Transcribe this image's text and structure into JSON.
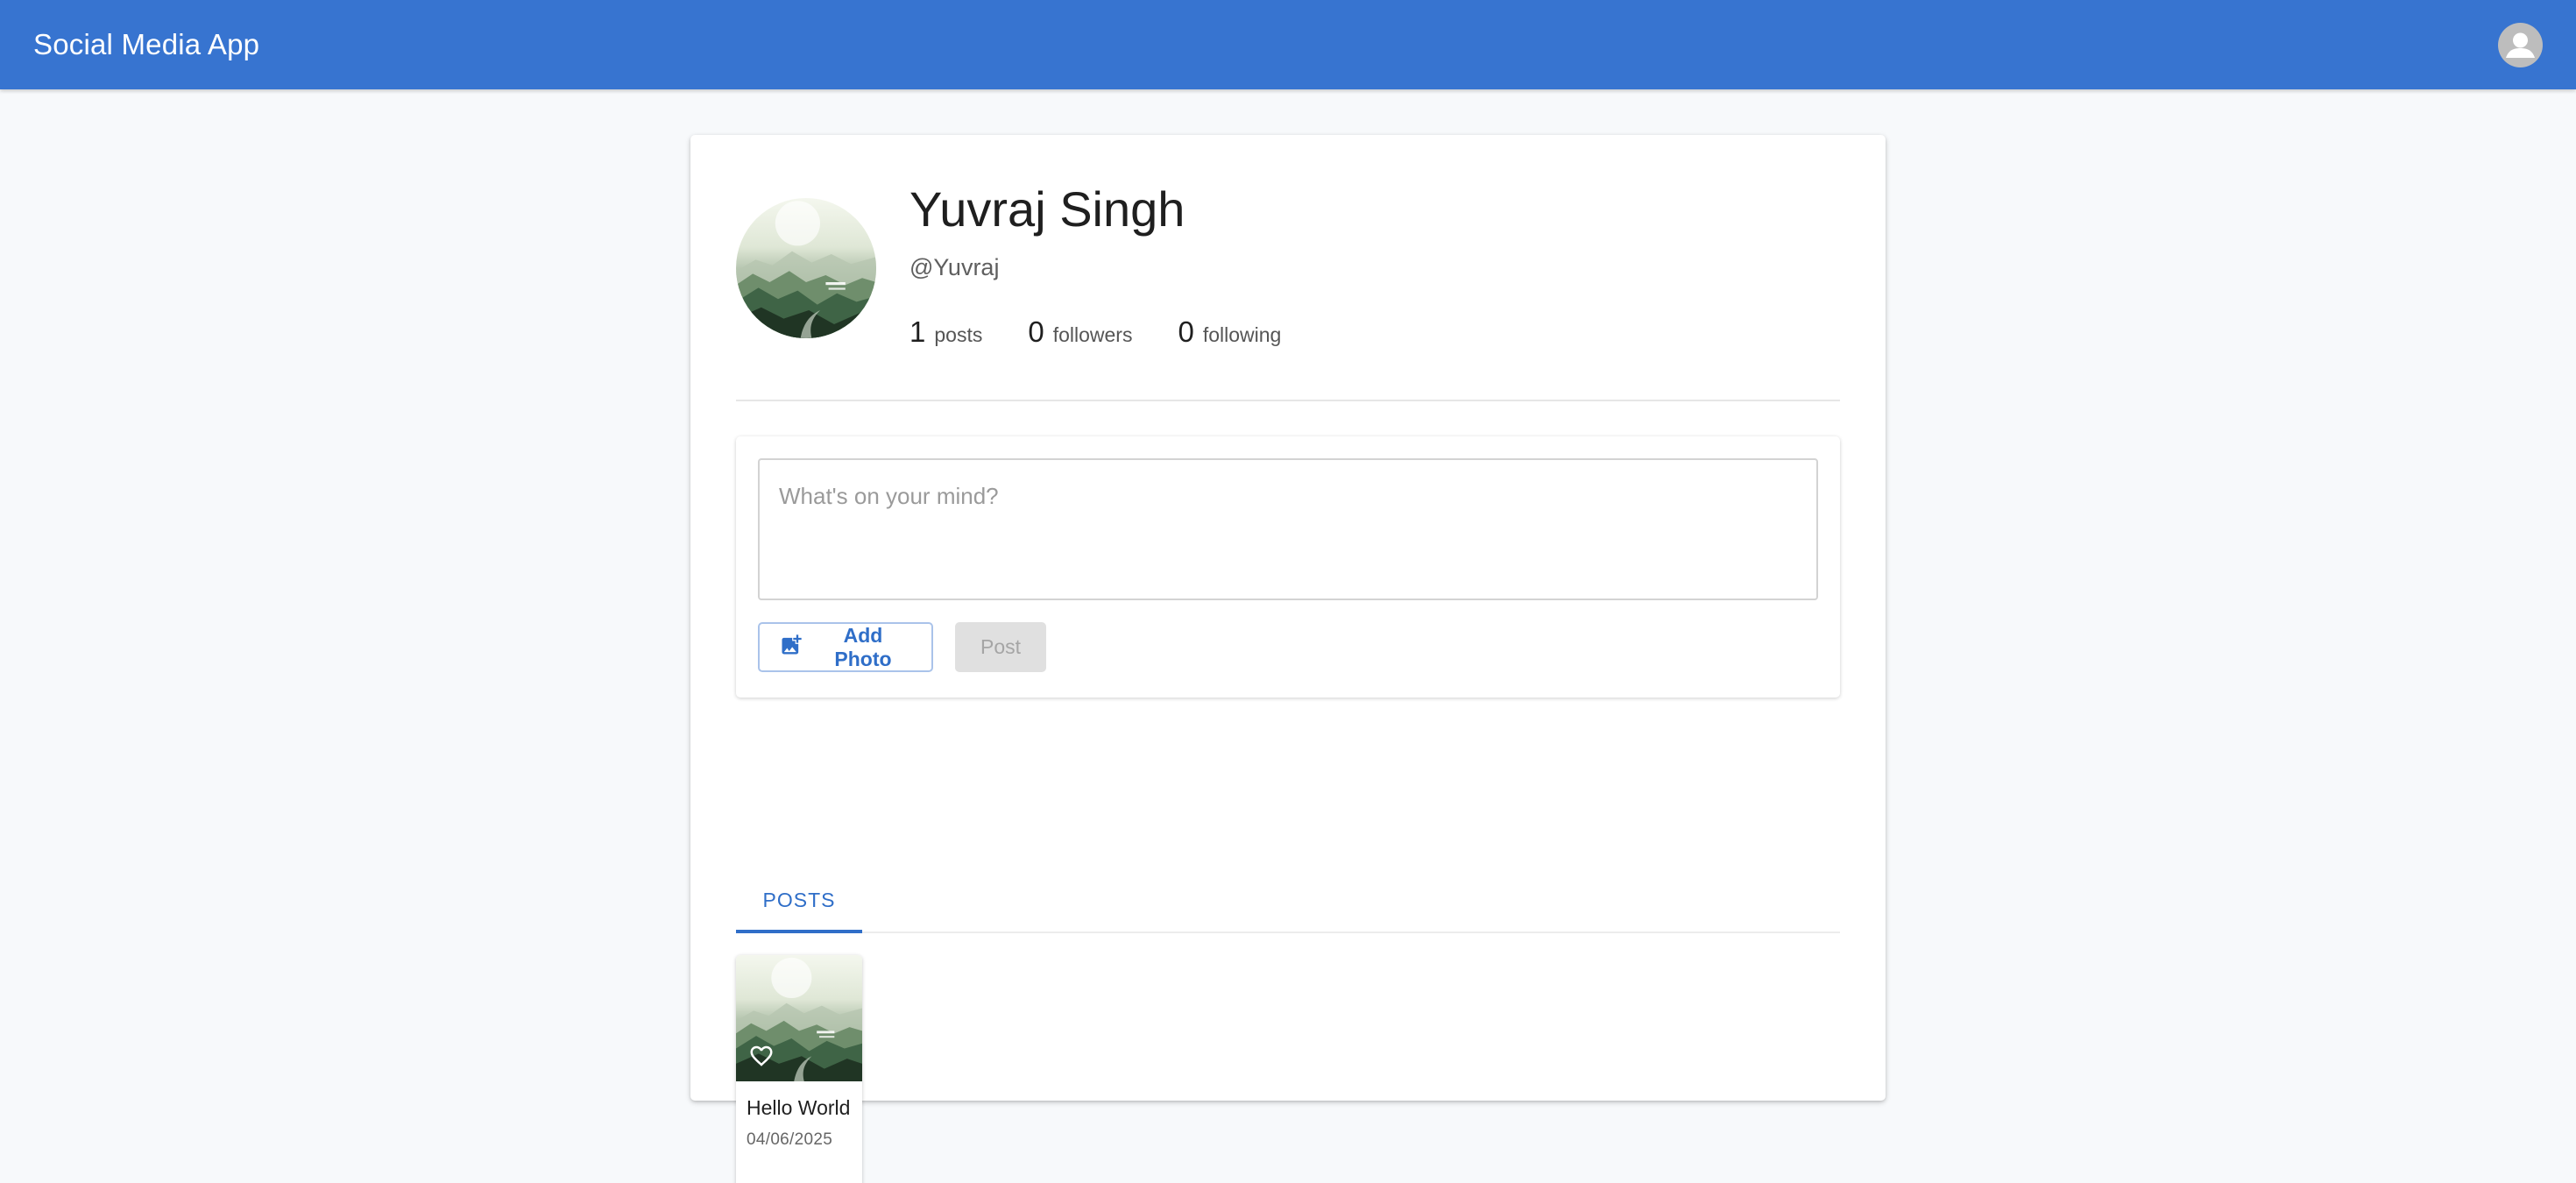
{
  "appbar": {
    "title": "Social Media App",
    "account_icon": "account-circle-icon",
    "color": "#3774d0"
  },
  "profile": {
    "name": "Yuvraj Singh",
    "handle": "@Yuvraj",
    "avatar_icon": "mountain-landscape-photo",
    "stats": [
      {
        "value": "1",
        "label": "posts"
      },
      {
        "value": "0",
        "label": "followers"
      },
      {
        "value": "0",
        "label": "following"
      }
    ]
  },
  "composer": {
    "placeholder": "What's on your mind?",
    "value": "",
    "add_photo_label": "Add Photo",
    "add_photo_icon": "add-photo-icon",
    "post_label": "Post",
    "post_enabled": false
  },
  "tabs": [
    {
      "label": "POSTS",
      "active": true
    }
  ],
  "posts": [
    {
      "title": "Hello World",
      "date": "04/06/2025",
      "liked": false
    }
  ],
  "colors": {
    "accent": "#2f6ec8",
    "background": "#f7f9fb"
  }
}
